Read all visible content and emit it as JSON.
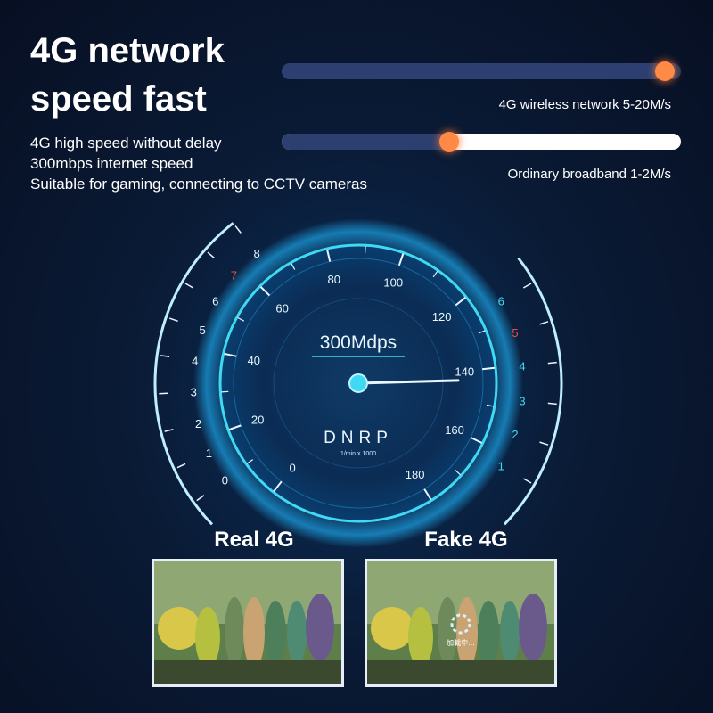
{
  "headline": {
    "line1": "4G network",
    "line2": "speed fast"
  },
  "features": [
    "4G high speed without delay",
    "300mbps internet speed",
    "Suitable for gaming, connecting to CCTV cameras"
  ],
  "speed_bars": [
    {
      "label": "4G wireless network 5-20M/s",
      "fraction": 0.96,
      "fill_color": "#2c3f70",
      "track_color": "#243560"
    },
    {
      "label": "Ordinary broadband 1-2M/s",
      "fraction": 0.42,
      "fill_color": "#2c3f70",
      "track_color": "#ffffff"
    }
  ],
  "gauge": {
    "speed_text": "300Mdps",
    "brand": "DNRP",
    "subtitle": "1/min x 1000",
    "main_ticks": [
      "0",
      "20",
      "40",
      "60",
      "80",
      "100",
      "120",
      "140",
      "160",
      "180"
    ],
    "left_ticks": [
      "0",
      "1",
      "2",
      "3",
      "4",
      "5",
      "6",
      "7",
      "8"
    ],
    "left_highlight": "7",
    "right_ticks": [
      "1",
      "2",
      "3",
      "4",
      "5",
      "6"
    ],
    "right_highlight": "5",
    "needle_value": 143,
    "accent_color": "#3fd8f5",
    "highlight_color": "#ff4a3a"
  },
  "comparison": {
    "real_label": "Real 4G",
    "fake_label": "Fake 4G",
    "loading_text": "加載中..."
  }
}
